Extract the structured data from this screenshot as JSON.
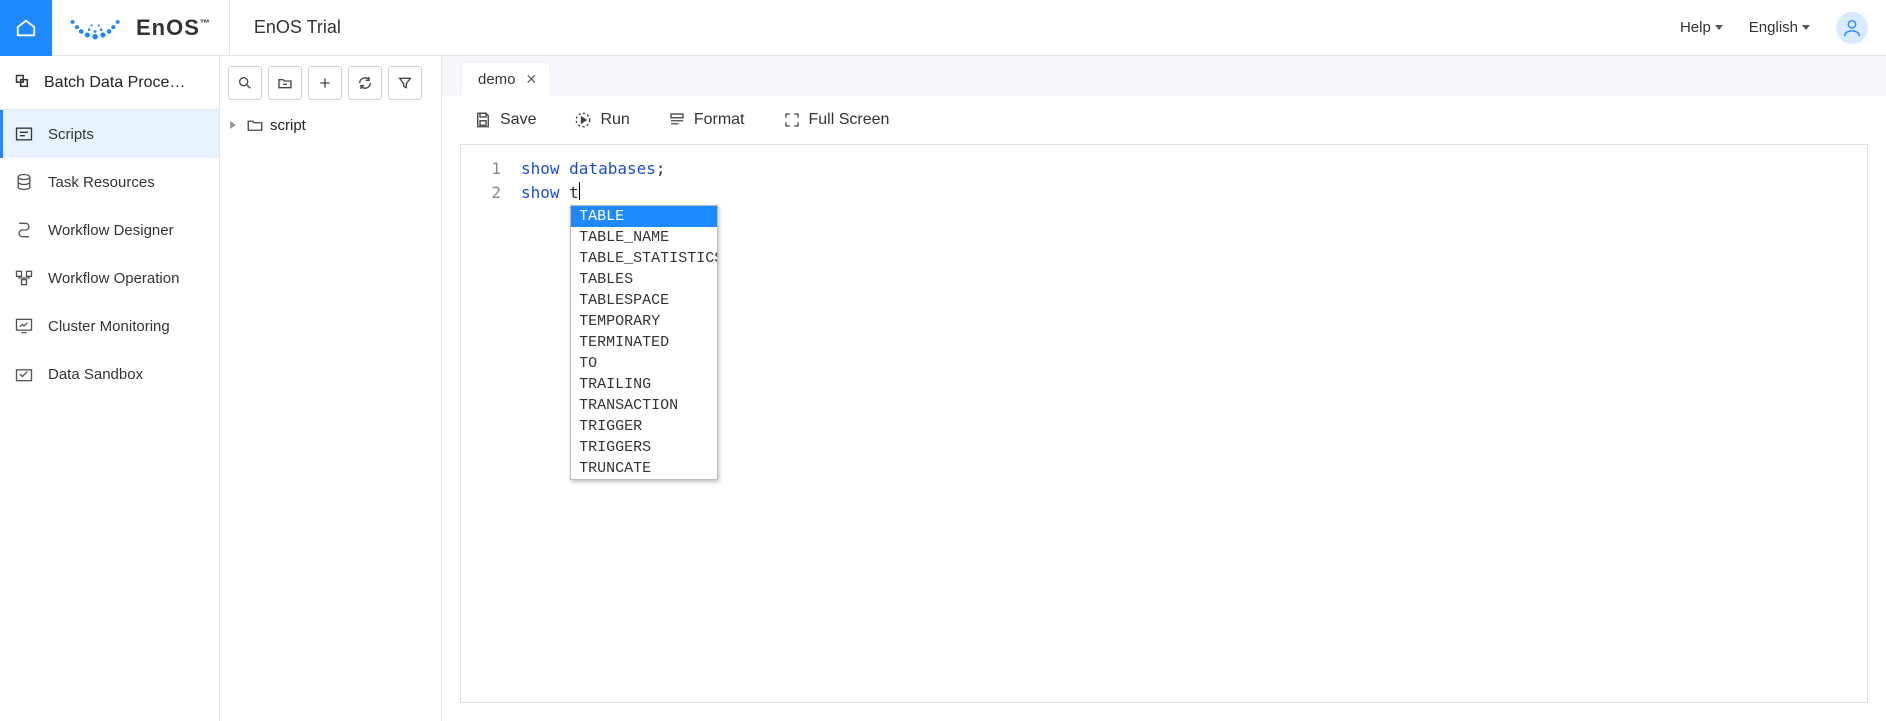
{
  "header": {
    "brand": "EnOS",
    "brand_tm": "™",
    "trial": "EnOS Trial",
    "help": "Help",
    "language": "English"
  },
  "sidebar": {
    "title": "Batch Data Proce…",
    "items": [
      {
        "label": "Scripts",
        "selected": true
      },
      {
        "label": "Task Resources",
        "selected": false
      },
      {
        "label": "Workflow Designer",
        "selected": false
      },
      {
        "label": "Workflow Operation",
        "selected": false
      },
      {
        "label": "Cluster Monitoring",
        "selected": false
      },
      {
        "label": "Data Sandbox",
        "selected": false
      }
    ]
  },
  "tree": {
    "items": [
      {
        "label": "script"
      }
    ]
  },
  "main": {
    "tab_label": "demo",
    "actions": {
      "save": "Save",
      "run": "Run",
      "format": "Format",
      "fullscreen": "Full Screen"
    },
    "code": {
      "line1_kw": "show ",
      "line1_id": "databases",
      "line1_tail": ";",
      "line2_kw": "show ",
      "line2_partial": "t"
    },
    "autocomplete": [
      "TABLE",
      "TABLE_NAME",
      "TABLE_STATISTICS",
      "TABLES",
      "TABLESPACE",
      "TEMPORARY",
      "TERMINATED",
      "TO",
      "TRAILING",
      "TRANSACTION",
      "TRIGGER",
      "TRIGGERS",
      "TRUNCATE"
    ],
    "autocomplete_selected_index": 0
  }
}
